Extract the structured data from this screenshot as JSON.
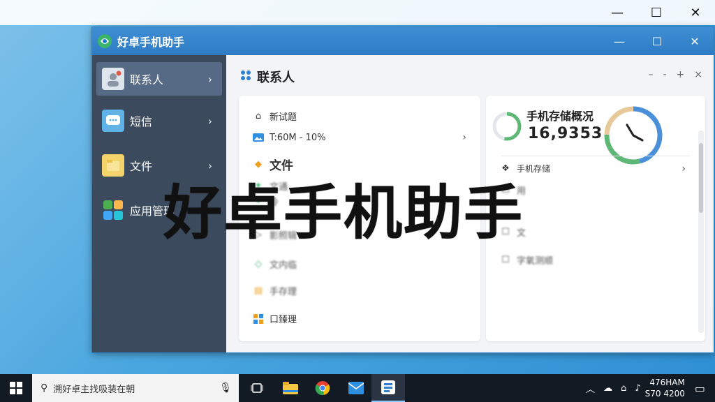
{
  "desktop": {
    "window_controls": {
      "minimize": "—",
      "maximize": "☐",
      "close": "✕"
    }
  },
  "app": {
    "title": "好卓手机助手",
    "controls": {
      "minimize": "—",
      "maximize": "☐",
      "close": "✕"
    }
  },
  "sidebar": {
    "items": [
      {
        "label": "联系人",
        "icon": "contact-icon",
        "active": true
      },
      {
        "label": "短信",
        "icon": "sms-icon"
      },
      {
        "label": "文件",
        "icon": "folder-icon"
      },
      {
        "label": "应用管理",
        "icon": "apps-icon"
      }
    ],
    "arrow": "›"
  },
  "main": {
    "title": "联系人",
    "header_controls": [
      "–",
      "-",
      "+",
      "×"
    ],
    "left_card": {
      "rows": [
        {
          "label": "新试题"
        },
        {
          "label": "T:60M - 10%",
          "arrow": "›"
        },
        {
          "label": "文件"
        },
        {
          "label": "文通"
        },
        {
          "label": "冷"
        },
        {
          "label": "影照辑"
        },
        {
          "label": "文内临"
        },
        {
          "label": "手存理"
        },
        {
          "label": "口臻理"
        }
      ]
    },
    "right_card": {
      "title": "手机存储概况",
      "value": "16,9353",
      "rows": [
        {
          "label": "手机存储",
          "arrow": "›"
        },
        {
          "label": "用"
        },
        {
          "label": "文"
        },
        {
          "label": "字氧测顺"
        }
      ],
      "ring_colors": [
        "#4a90d9",
        "#5cb874",
        "#e8c99a"
      ]
    }
  },
  "overlay": {
    "text": "好卓手机助手"
  },
  "taskbar": {
    "search_text": "溯好卓主找吸装在朝",
    "clock": {
      "line1": "476HAM",
      "line2": "S70 4200"
    }
  }
}
